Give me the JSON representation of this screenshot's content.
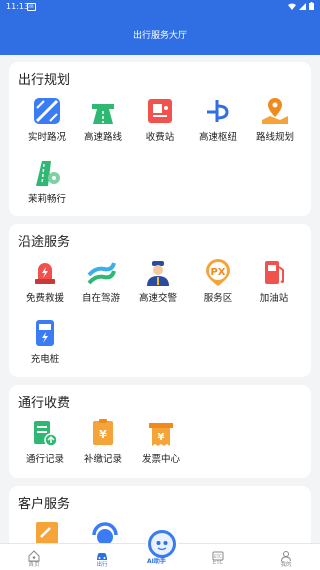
{
  "status_bar": {
    "time": "11:13"
  },
  "header": {
    "title": "出行服务大厅"
  },
  "sections": [
    {
      "title": "出行规划",
      "items": [
        {
          "label": "实时路况",
          "icon": "traffic-map-icon"
        },
        {
          "label": "高速路线",
          "icon": "highway-road-icon"
        },
        {
          "label": "收费站",
          "icon": "toll-station-icon"
        },
        {
          "label": "高速枢纽",
          "icon": "hub-icon"
        },
        {
          "label": "路线规划",
          "icon": "route-plan-icon"
        },
        {
          "label": "茉莉畅行",
          "icon": "jasmine-road-icon"
        }
      ]
    },
    {
      "title": "沿途服务",
      "items": [
        {
          "label": "免费救援",
          "icon": "rescue-siren-icon"
        },
        {
          "label": "自在驾游",
          "icon": "scenic-drive-icon"
        },
        {
          "label": "高速交警",
          "icon": "police-icon"
        },
        {
          "label": "服务区",
          "icon": "service-area-icon"
        },
        {
          "label": "加油站",
          "icon": "gas-station-icon"
        },
        {
          "label": "充电桩",
          "icon": "charging-pile-icon"
        }
      ]
    },
    {
      "title": "通行收费",
      "items": [
        {
          "label": "通行记录",
          "icon": "pass-record-icon"
        },
        {
          "label": "补缴记录",
          "icon": "repay-record-icon"
        },
        {
          "label": "发票中心",
          "icon": "invoice-icon"
        }
      ]
    },
    {
      "title": "客户服务",
      "items": [
        {
          "label": "",
          "icon": "feedback-icon"
        },
        {
          "label": "",
          "icon": "customer-service-icon"
        }
      ]
    }
  ],
  "bottom_nav": {
    "items": [
      {
        "label": "首页",
        "icon": "home-icon"
      },
      {
        "label": "出行",
        "icon": "car-icon"
      },
      {
        "label": "AI助手",
        "icon": "ai-assistant-icon"
      },
      {
        "label": "ETC",
        "icon": "etc-icon"
      },
      {
        "label": "我的",
        "icon": "profile-icon"
      }
    ]
  },
  "colors": {
    "brand": "#2f6fe3",
    "card": "#ffffff",
    "background": "#f3f4f6"
  }
}
